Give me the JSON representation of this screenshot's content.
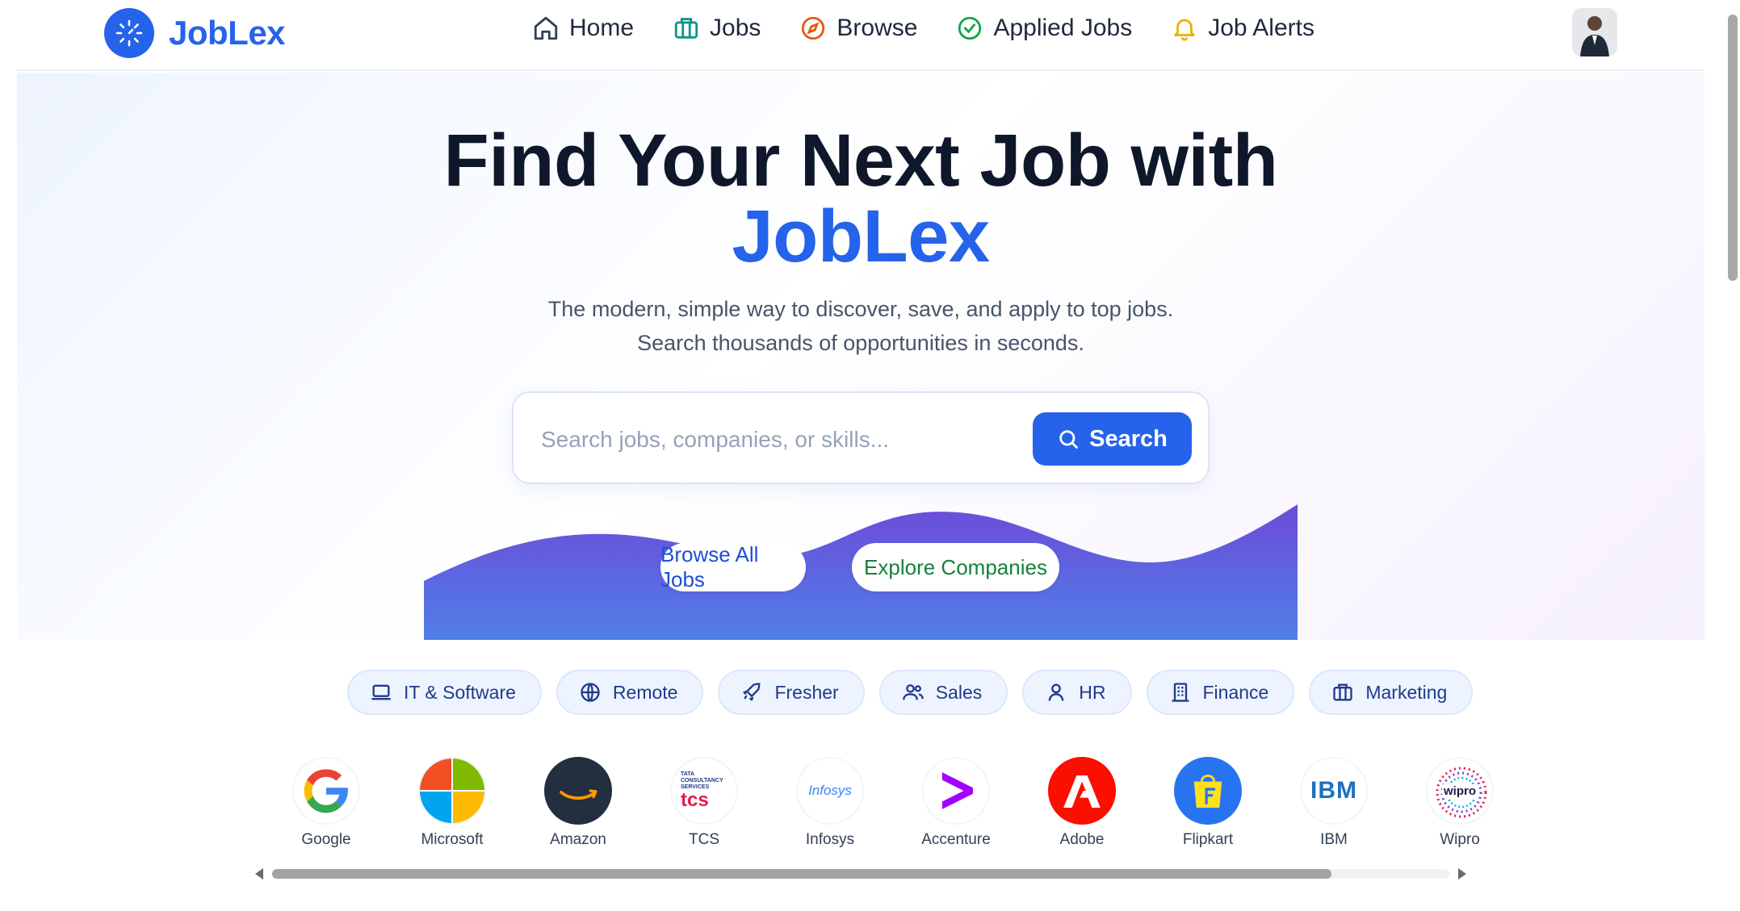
{
  "brand": {
    "name": "JobLex",
    "color": "#2563eb"
  },
  "nav": {
    "items": [
      {
        "label": "Home",
        "icon": "home-icon"
      },
      {
        "label": "Jobs",
        "icon": "briefcase-icon"
      },
      {
        "label": "Browse",
        "icon": "compass-icon"
      },
      {
        "label": "Applied Jobs",
        "icon": "check-circle-icon"
      },
      {
        "label": "Job Alerts",
        "icon": "bell-icon"
      }
    ],
    "avatar": "user-avatar"
  },
  "hero": {
    "title": "Find Your Next Job with",
    "title_brand": "JobLex",
    "subtitle_line1": "The modern, simple way to discover, save, and apply to top jobs.",
    "subtitle_line2": "Search thousands of opportunities in seconds.",
    "search_placeholder": "Search jobs, companies, or skills...",
    "search_button": "Search",
    "browse_button": "Browse All Jobs",
    "explore_button": "Explore Companies"
  },
  "categories": [
    {
      "label": "IT & Software",
      "icon": "laptop-icon"
    },
    {
      "label": "Remote",
      "icon": "globe-icon"
    },
    {
      "label": "Fresher",
      "icon": "rocket-icon"
    },
    {
      "label": "Sales",
      "icon": "users-icon"
    },
    {
      "label": "HR",
      "icon": "user-icon"
    },
    {
      "label": "Finance",
      "icon": "building-icon"
    },
    {
      "label": "Marketing",
      "icon": "briefcase-icon"
    }
  ],
  "companies": [
    {
      "name": "Google"
    },
    {
      "name": "Microsoft"
    },
    {
      "name": "Amazon"
    },
    {
      "name": "TCS",
      "logo_text": "tcs",
      "logo_small": "TATA CONSULTANCY SERVICES"
    },
    {
      "name": "Infosys",
      "logo_text": "Infosys"
    },
    {
      "name": "Accenture"
    },
    {
      "name": "Adobe"
    },
    {
      "name": "Flipkart"
    },
    {
      "name": "IBM",
      "logo_text": "IBM"
    },
    {
      "name": "Wipro",
      "logo_text": "wipro"
    }
  ],
  "colors": {
    "accent": "#2563eb",
    "explore_green": "#15803d",
    "wave_top": "#6d4bd8",
    "wave_bottom": "#4f7fe8"
  }
}
